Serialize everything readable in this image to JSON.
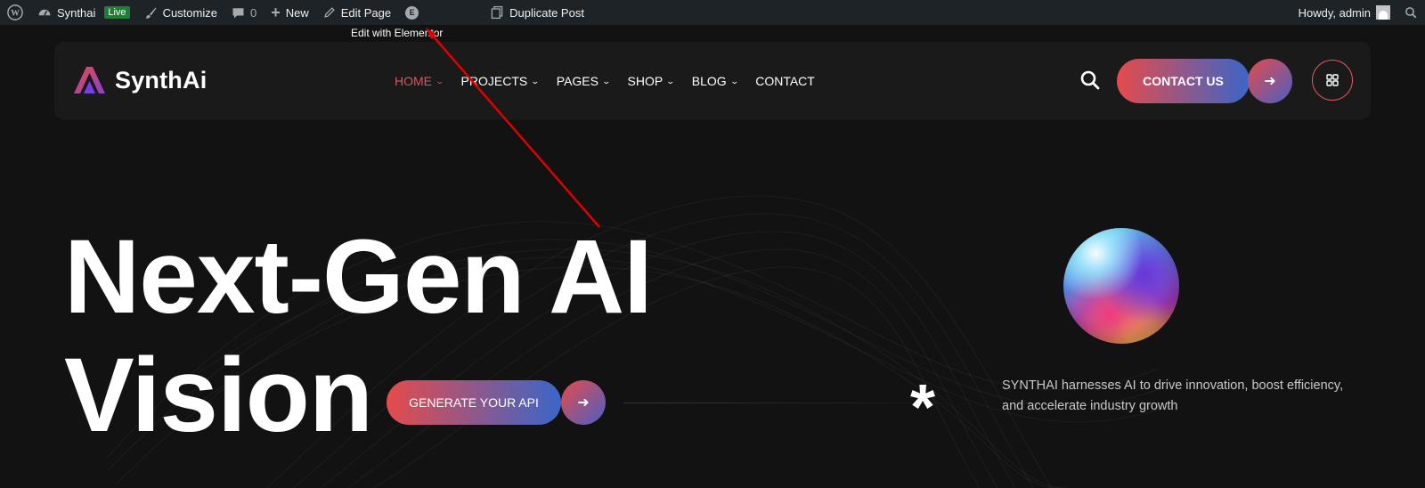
{
  "admin_bar": {
    "site_name": "Synthai",
    "live_badge": "Live",
    "customize": "Customize",
    "comments_count": "0",
    "new_label": "New",
    "edit_page": "Edit Page",
    "duplicate_post": "Duplicate Post",
    "howdy": "Howdy, admin",
    "tooltip": "Edit with Elementor"
  },
  "header": {
    "logo_text": "SynthAi",
    "nav": [
      {
        "label": "HOME",
        "active": true,
        "has_dropdown": true
      },
      {
        "label": "PROJECTS",
        "active": false,
        "has_dropdown": true
      },
      {
        "label": "PAGES",
        "active": false,
        "has_dropdown": true
      },
      {
        "label": "SHOP",
        "active": false,
        "has_dropdown": true
      },
      {
        "label": "BLOG",
        "active": false,
        "has_dropdown": true
      },
      {
        "label": "CONTACT",
        "active": false,
        "has_dropdown": false
      }
    ],
    "contact_button": "CONTACT US",
    "icons": [
      "search-icon",
      "arrow-right-icon",
      "grid-menu-icon"
    ]
  },
  "hero": {
    "title_line1": "Next-Gen AI",
    "title_line2": "Vision",
    "cta_button": "GENERATE YOUR API",
    "description": "SYNTHAI harnesses AI to drive innovation, boost efficiency, and accelerate industry growth",
    "decor_symbol": "*"
  },
  "colors": {
    "accent_red": "#e2525a",
    "gradient_start": "#e54b4b",
    "gradient_end": "#3a66c9",
    "background": "#121213",
    "admin_bar": "#1d2327",
    "annotation_arrow": "#e00000"
  }
}
